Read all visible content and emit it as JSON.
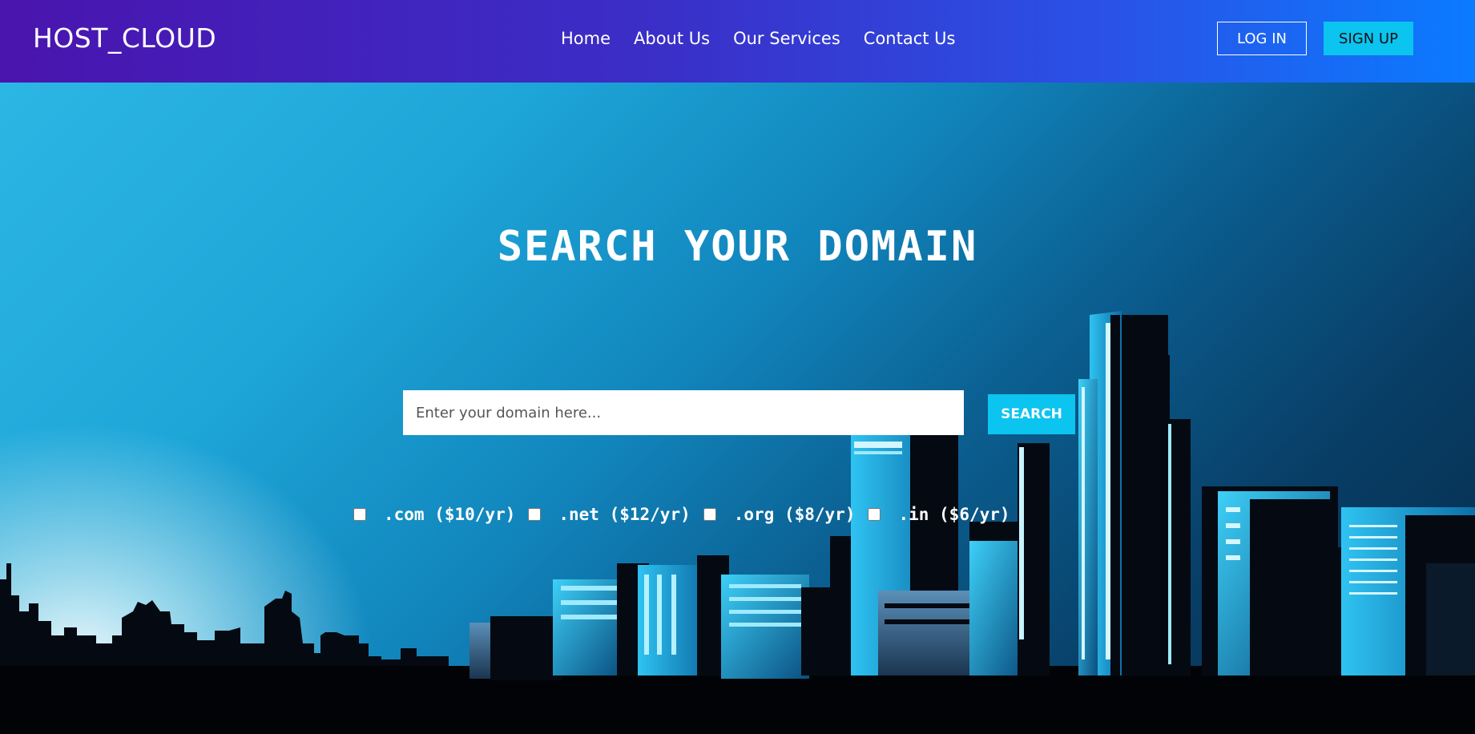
{
  "header": {
    "logo": "HOST_CLOUD",
    "nav": [
      "Home",
      "About Us",
      "Our Services",
      "Contact Us"
    ],
    "login_label": "LOG IN",
    "signup_label": "SIGN UP"
  },
  "hero": {
    "title": "SEARCH YOUR DOMAIN",
    "search_placeholder": "Enter your domain here...",
    "search_value": "",
    "search_button": "SEARCH",
    "tlds": [
      {
        "label": ".com ($10/yr)",
        "checked": false
      },
      {
        "label": ".net ($12/yr)",
        "checked": false
      },
      {
        "label": ".org ($8/yr)",
        "checked": false
      },
      {
        "label": ".in ($6/yr)",
        "checked": false
      }
    ]
  },
  "colors": {
    "header_gradient_start": "#4a14ae",
    "header_gradient_end": "#0a7bff",
    "accent": "#0cc4f0",
    "sky_light": "#e8f6fb",
    "sky_dark": "#062a48"
  }
}
